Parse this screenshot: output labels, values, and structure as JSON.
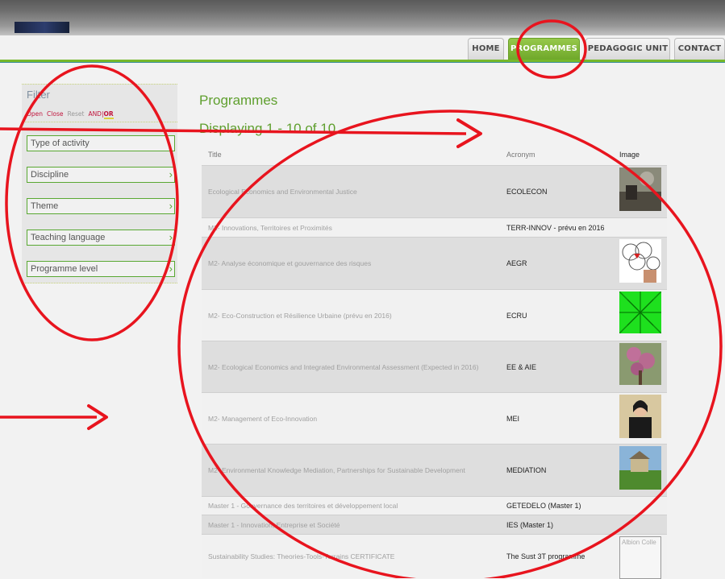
{
  "nav": {
    "home": "HOME",
    "programmes": "PROGRAMMES",
    "pedagogic_unit": "PEDAGOGIC UNIT",
    "contact": "CONTACT"
  },
  "sidebar": {
    "title": "Filter",
    "controls": {
      "open": "Open",
      "close": "Close",
      "reset": "Reset",
      "and": "AND",
      "sep": "|",
      "or": "OR"
    },
    "filters": [
      "Type of activity",
      "Discipline",
      "Theme",
      "Teaching language",
      "Programme level"
    ]
  },
  "main": {
    "title": "Programmes",
    "display_count": "Displaying 1 - 10 of 10",
    "columns": {
      "title": "Title",
      "acronym": "Acronym",
      "image": "Image"
    },
    "rows": [
      {
        "title": "Ecological Economics and Environmental Justice",
        "acronym": "ECOLECON"
      },
      {
        "title": "M2- Innovations, Territoires et Proximités",
        "acronym": "TERR-INNOV - prévu en 2016"
      },
      {
        "title": "M2- Analyse économique et gouvernance des risques",
        "acronym": "AEGR"
      },
      {
        "title": "M2- Eco-Construction et Résilience Urbaine (prévu en 2016)",
        "acronym": "ECRU"
      },
      {
        "title": "M2- Ecological Economics and Integrated Environmental Assessment (Expected in 2016)",
        "acronym": "EE & AIE"
      },
      {
        "title": "M2- Management of Eco-Innovation",
        "acronym": "MEI"
      },
      {
        "title": "M2- Environmental Knowledge Mediation, Partnerships for Sustainable Development",
        "acronym": "MEDIATION"
      },
      {
        "title": "Master 1 - Gouvernance des territoires et développement local",
        "acronym": "GETEDELO (Master 1)"
      },
      {
        "title": "Master 1 - Innovation, Entreprise et Société",
        "acronym": "IES (Master 1)"
      },
      {
        "title": "Sustainability Studies: Theories-Tools-Terrains CERTIFICATE",
        "acronym": "The Sust 3T programme"
      }
    ],
    "image_placeholder_text": "Albion Colle"
  },
  "colors": {
    "accent_green": "#76b82a",
    "annotation_red": "#e8141e"
  }
}
